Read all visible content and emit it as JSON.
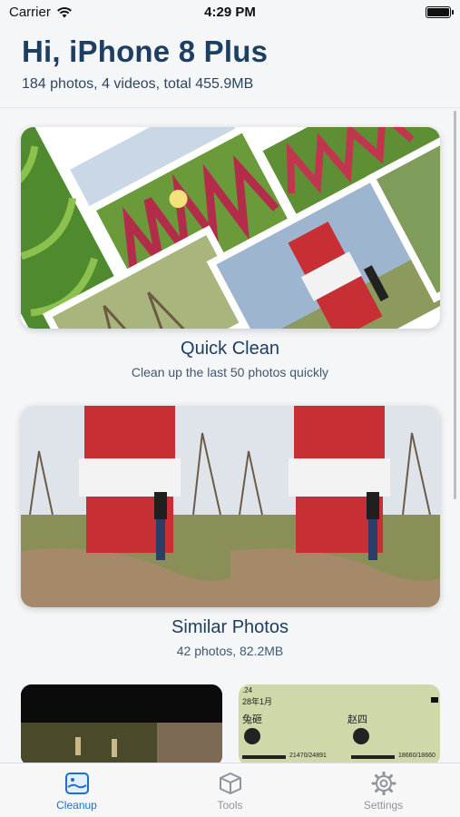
{
  "status_bar": {
    "carrier": "Carrier",
    "time": "4:29 PM",
    "battery_level": 1.0
  },
  "header": {
    "greeting": "Hi, iPhone 8 Plus",
    "summary": "184 photos, 4 videos, total 455.9MB"
  },
  "quick_clean": {
    "title": "Quick Clean",
    "subtitle": "Clean up the last 50 photos quickly"
  },
  "similar_photos": {
    "title": "Similar Photos",
    "subtitle": "42 photos, 82.2MB"
  },
  "game_thumb": {
    "top_line": ".24",
    "date": "28年1月",
    "player1": "兔砸",
    "player2": "赵四",
    "score1": "21470/24891",
    "score2": "18660/18660"
  },
  "tabs": [
    {
      "label": "Cleanup",
      "icon": "photo-icon",
      "active": true
    },
    {
      "label": "Tools",
      "icon": "cube-icon",
      "active": false
    },
    {
      "label": "Settings",
      "icon": "gear-icon",
      "active": false
    }
  ],
  "colors": {
    "accent": "#1a6fd0",
    "title": "#1c3f62",
    "tab_inactive": "#8e949b"
  }
}
